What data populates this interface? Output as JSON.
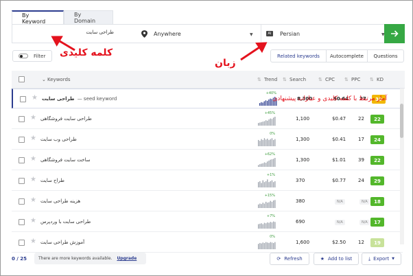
{
  "tabs": [
    {
      "label": "By Keyword"
    },
    {
      "label": "By Domain"
    }
  ],
  "search": {
    "keyword_value": "طراحی سایت",
    "location": "Anywhere",
    "language": "Persian",
    "lang_icon": "AI"
  },
  "filter": {
    "label": "Filter"
  },
  "view_tabs": [
    "Related keywords",
    "Autocomplete",
    "Questions"
  ],
  "table": {
    "headers": {
      "keywords": "Keywords",
      "trend": "Trend",
      "search": "Search",
      "cpc": "CPC",
      "ppc": "PPC",
      "kd": "KD"
    },
    "rows": [
      {
        "keyword": "طراحی سایت",
        "seed": "— seed keyword",
        "trend_pct": "+40%",
        "search": "8,300",
        "cpc": "$0.64",
        "ppc": "27",
        "kd": "30",
        "kd_color": "#f2b705",
        "trend_vals": [
          0.3,
          0.4,
          0.35,
          0.5,
          0.6,
          0.55,
          0.7,
          0.8,
          0.75,
          0.9,
          1.0,
          0.85
        ]
      },
      {
        "keyword": "طراحی سایت فروشگاهی",
        "trend_pct": "+45%",
        "search": "1,100",
        "cpc": "$0.47",
        "ppc": "22",
        "kd": "22",
        "kd_color": "#53b72b",
        "trend_vals": [
          0.3,
          0.35,
          0.4,
          0.45,
          0.5,
          0.6,
          0.55,
          0.7,
          0.8,
          0.75,
          0.9,
          1.0
        ]
      },
      {
        "keyword": "طراحی وب سایت",
        "trend_pct": "0%",
        "search": "1,300",
        "cpc": "$0.41",
        "ppc": "17",
        "kd": "24",
        "kd_color": "#53b72b",
        "trend_vals": [
          0.7,
          0.6,
          0.8,
          0.7,
          0.9,
          0.75,
          0.85,
          0.7,
          0.8,
          0.9,
          0.7,
          0.8
        ]
      },
      {
        "keyword": "ساخت سایت فروشگاهی",
        "trend_pct": "+62%",
        "search": "1,300",
        "cpc": "$1.01",
        "ppc": "39",
        "kd": "22",
        "kd_color": "#53b72b",
        "trend_vals": [
          0.2,
          0.3,
          0.35,
          0.4,
          0.5,
          0.45,
          0.6,
          0.7,
          0.8,
          0.85,
          0.9,
          1.0
        ]
      },
      {
        "keyword": "طراح سایت",
        "trend_pct": "+1%",
        "search": "370",
        "cpc": "$0.77",
        "ppc": "24",
        "kd": "29",
        "kd_color": "#53b72b",
        "trend_vals": [
          0.6,
          0.7,
          0.5,
          0.8,
          0.6,
          0.7,
          0.9,
          0.6,
          0.7,
          0.8,
          0.6,
          0.7
        ]
      },
      {
        "keyword": "هزینه طراحی سایت",
        "trend_pct": "+15%",
        "search": "380",
        "cpc": "N/A",
        "ppc": "N/A",
        "kd": "18",
        "kd_color": "#53b72b",
        "trend_vals": [
          0.4,
          0.5,
          0.45,
          0.6,
          0.5,
          0.7,
          0.6,
          0.65,
          0.8,
          0.7,
          0.85,
          0.9
        ]
      },
      {
        "keyword": "طراحی سایت با وردپرس",
        "trend_pct": "+7%",
        "search": "690",
        "cpc": "N/A",
        "ppc": "N/A",
        "kd": "17",
        "kd_color": "#53b72b",
        "trend_vals": [
          0.5,
          0.55,
          0.6,
          0.5,
          0.65,
          0.6,
          0.7,
          0.65,
          0.75,
          0.7,
          0.8,
          0.75
        ]
      },
      {
        "keyword": "آموزش طراحی سایت",
        "trend_pct": "0%",
        "search": "1,600",
        "cpc": "$2.50",
        "ppc": "12",
        "kd": "19",
        "kd_color": "#c8e29a",
        "trend_vals": [
          0.6,
          0.7,
          0.65,
          0.75,
          0.7,
          0.8,
          0.75,
          0.7,
          0.8,
          0.75,
          0.7,
          0.8
        ]
      }
    ]
  },
  "footer": {
    "count": "0 / 25",
    "more_text": "There are more keywords available.",
    "upgrade": "Upgrade",
    "refresh": "Refresh",
    "add_to_list": "Add to list",
    "export": "Export"
  },
  "annotations": {
    "keyword": "کلمه کلیدی",
    "language": "زبان",
    "stats": "آمار مرتبط با کلمه کلیدی و عبارات پیشنهادی"
  },
  "colors": {
    "accent": "#2b3c8f",
    "go": "#36a844",
    "annotation": "#e4121d"
  }
}
